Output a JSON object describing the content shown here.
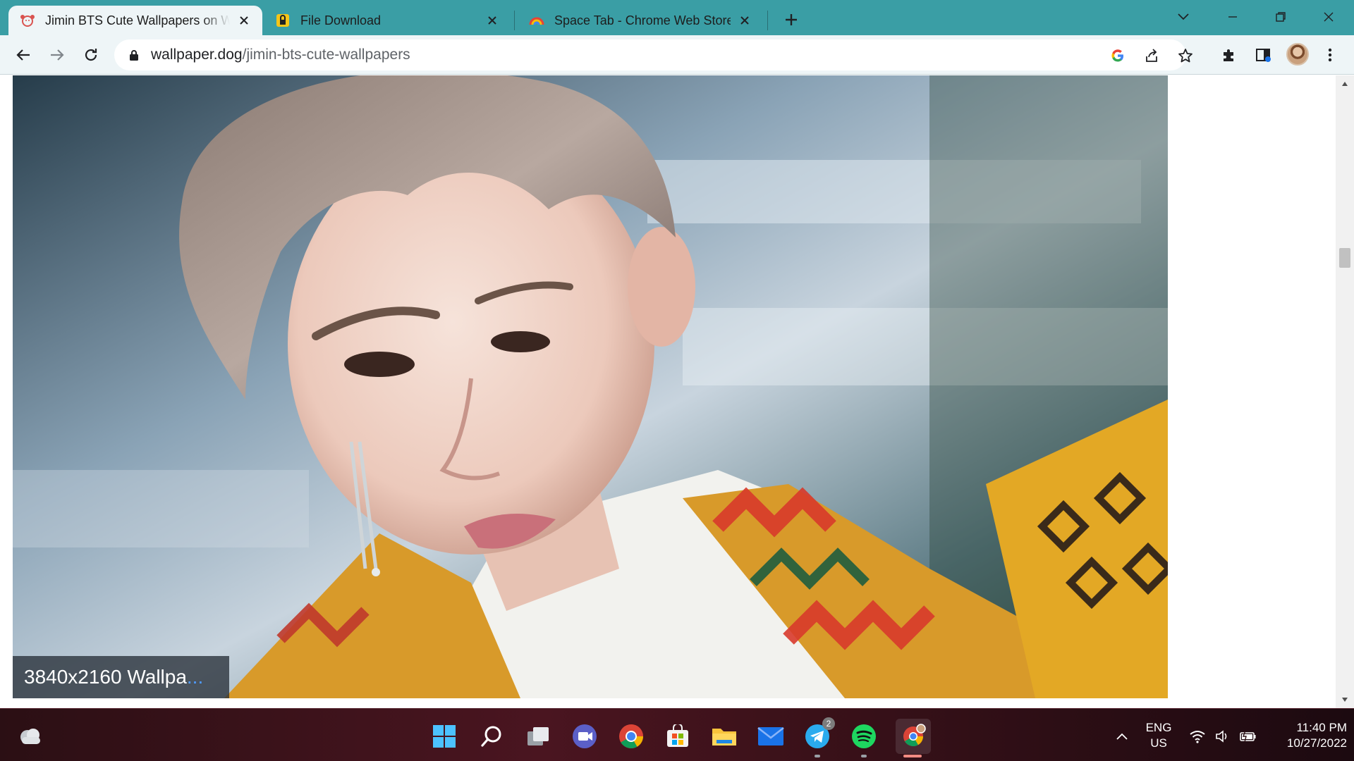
{
  "browser": {
    "tabs": [
      {
        "title": "Jimin BTS Cute Wallpapers on Wa",
        "active": true,
        "favicon": "dog-icon"
      },
      {
        "title": "File Download",
        "active": false,
        "favicon": "lock-yellow-icon"
      },
      {
        "title": "Space Tab - Chrome Web Store",
        "active": false,
        "favicon": "rainbow-icon"
      }
    ],
    "address": {
      "domain": "wallpaper.dog",
      "path": "/jimin-bts-cute-wallpapers"
    }
  },
  "page": {
    "caption": "3840x2160 Wallpa",
    "caption_ellipsis": "..."
  },
  "taskbar": {
    "apps": [
      "start",
      "search",
      "task-view",
      "teams",
      "chrome",
      "store",
      "file-explorer",
      "mail",
      "telegram",
      "spotify",
      "chrome-profile"
    ],
    "telegram_badge": "2",
    "language_top": "ENG",
    "language_bottom": "US",
    "time": "11:40 PM",
    "date": "10/27/2022"
  },
  "colors": {
    "tab_strip": "#3a9ea5",
    "toolbar": "#eef5f7",
    "taskbar": "#3a1119"
  }
}
